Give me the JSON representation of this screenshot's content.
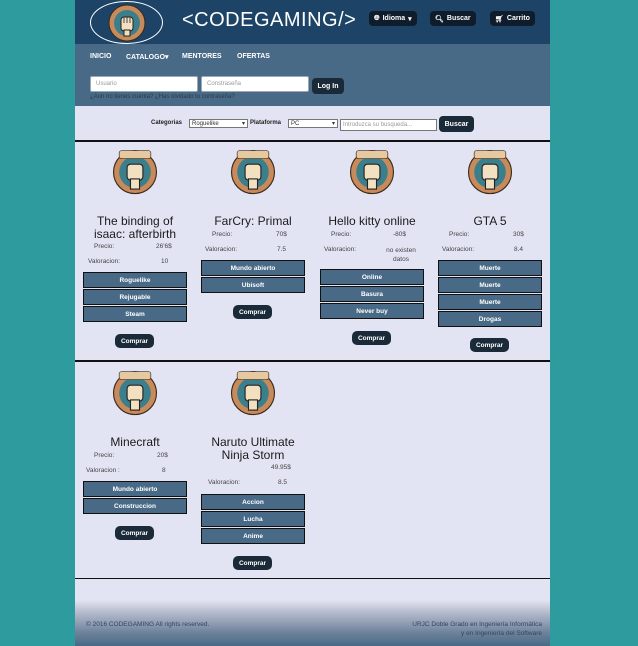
{
  "header": {
    "site_title": "<CODEGAMING/>",
    "logo_icon": "fist-badge-icon",
    "language_button": "Idioma",
    "search_button": "Buscar",
    "cart_button": "Carrito"
  },
  "nav": {
    "items": [
      "INICIO",
      "CATALOGO",
      "MENTORES",
      "OFERTAS"
    ]
  },
  "login": {
    "user_placeholder": "Usuario",
    "password_placeholder": "Constraseña",
    "login_button": "Log In",
    "help_text": "¿Aun no tienes cuenta? ¿Has olvidado tu contraseña?"
  },
  "search": {
    "category_label": "Categorias",
    "category_value": "Roguelike",
    "platform_label": "Plataforma",
    "platform_value": "PC",
    "input_placeholder": "Introduzca su busqueda...",
    "button": "Buscar"
  },
  "games": [
    {
      "title": "The binding of isaac: afterbirth",
      "price_label": "Precio:",
      "price": "26'6$",
      "rating_label": "Valoracion:",
      "rating": "10",
      "tags": [
        "Roguelike",
        "Rejugable",
        "Steam"
      ],
      "buy": "Comprar"
    },
    {
      "title": "FarCry: Primal",
      "price_label": "Precio:",
      "price": "70$",
      "rating_label": "Valoracion:",
      "rating": "7.5",
      "tags": [
        "Mundo abierto",
        "Ubisoft"
      ],
      "buy": "Comprar"
    },
    {
      "title": "Hello kitty online",
      "price_label": "Precio:",
      "price": "-80$",
      "rating_label": "Valoracion:",
      "rating": "no existen datos",
      "tags": [
        "Online",
        "Basura",
        "Never buy"
      ],
      "buy": "Comprar"
    },
    {
      "title": "GTA 5",
      "price_label": "Precio:",
      "price": "30$",
      "rating_label": "Valoracion:",
      "rating": "8.4",
      "tags": [
        "Muerte",
        "Muerte",
        "Muerte",
        "Drogas"
      ],
      "buy": "Comprar"
    },
    {
      "title": "Minecraft",
      "price_label": "Precio:",
      "price": "20$",
      "rating_label": "Valoracion :",
      "rating": "8",
      "tags": [
        "Mundo abierto",
        "Construccion"
      ],
      "buy": "Comprar"
    },
    {
      "title": "Naruto Ultimate Ninja Storm",
      "price_label": "Precio:",
      "price": "49.95$",
      "rating_label": "Valoracion:",
      "rating": "8.5",
      "tags": [
        "Accion",
        "Lucha",
        "Anime"
      ],
      "buy": "Comprar"
    }
  ],
  "footer": {
    "copyright": "© 2016 CODEGAMING All rights reserved.",
    "credit_line1": "URJC Doble Grado en Ingeniería Informática",
    "credit_line2": "y en Ingeniería del Software"
  },
  "colors": {
    "page_bg": "#2e9c9e",
    "header_bg": "#1d4466",
    "nav_bg": "#486a86",
    "content_bg": "#e3e4f3",
    "button_dark": "#1a2a38",
    "tag_bg": "#486a86"
  }
}
